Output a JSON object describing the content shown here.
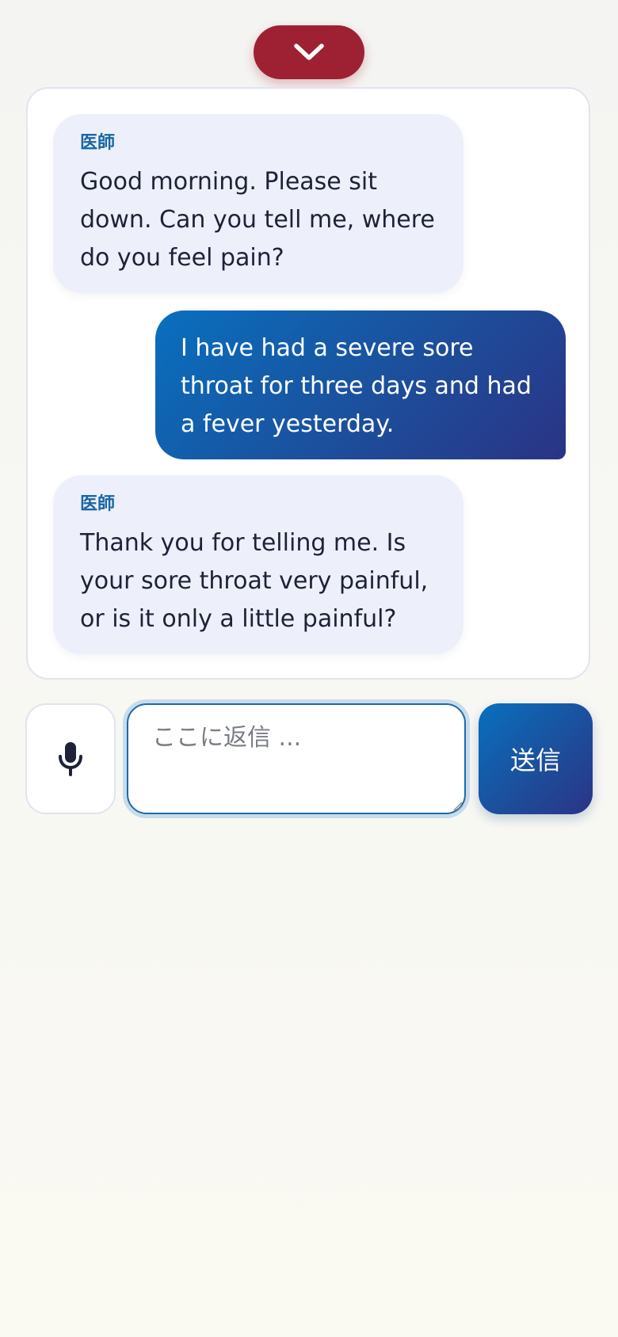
{
  "header": {
    "collapse_icon": "chevron-down-icon",
    "collapse_color": "#9e2133"
  },
  "messages": [
    {
      "role": "doctor",
      "sender": "医師",
      "text": "Good morning. Please sit down. Can you tell me, where do you feel pain?"
    },
    {
      "role": "user",
      "text": "I have had a severe sore throat for three days and had a fever yesterday."
    },
    {
      "role": "doctor",
      "sender": "医師",
      "text": "Thank you for telling me. Is your sore throat very painful, or is it only a little painful?"
    }
  ],
  "composer": {
    "mic_icon": "microphone-icon",
    "placeholder": "ここに返信 ...",
    "value": "",
    "send_label": "送信"
  },
  "colors": {
    "accent_gradient_start": "#0870bf",
    "accent_gradient_end": "#2b3385",
    "doctor_bubble": "#edf0fa",
    "sender_label": "#1a66a6"
  }
}
